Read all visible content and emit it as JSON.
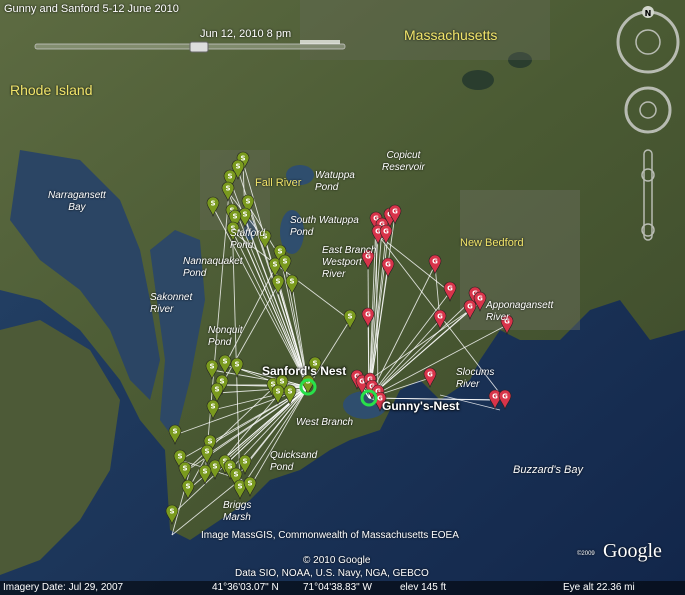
{
  "title": "Gunny and Sanford 5-12 June 2010",
  "timeslider": {
    "label": "Jun 12, 2010   8 pm"
  },
  "regions": {
    "massachusetts": "Massachusetts",
    "rhode_island": "Rhode Island"
  },
  "cities": {
    "fall_river": "Fall River",
    "new_bedford": "New Bedford"
  },
  "water": {
    "narragansett": "Narragansett\nBay",
    "watuppa": "Watuppa\nPond",
    "copicut": "Copicut\nReservoir",
    "south_watuppa": "South Watuppa\nPond",
    "stafford": "Stafford\nPond",
    "nannaquaket": "Nannaquaket\nPond",
    "east_branch": "East Branch\nWestport\nRiver",
    "sakonnet": "Sakonnet\nRiver",
    "nonquit": "Nonquit\nPond",
    "apponagansett": "Apponagansett\nRiver",
    "slocums": "Slocums\nRiver",
    "west_branch": "West Branch",
    "quicksand": "Quicksand\nPond",
    "briggs": "Briggs\nMarsh",
    "buzzards": "Buzzard's Bay"
  },
  "nests": {
    "sanford": "Sanford's Nest",
    "gunny": "Gunny's-Nest"
  },
  "credits": {
    "image": "Image MassGIS, Commonwealth of Massachusetts EOEA",
    "copyright": "© 2010 Google",
    "data": "Data SIO, NOAA, U.S. Navy, NGA, GEBCO",
    "logo_small": "©2009",
    "logo": "Google"
  },
  "compass": {
    "north": "N"
  },
  "status": {
    "imagery_date": "Imagery Date: Jul 29, 2007",
    "lat": "41°36'03.07\" N",
    "lon": "71°04'38.83\" W",
    "elev": "elev   145 ft",
    "eye_alt": "Eye alt    22.36 mi"
  },
  "colors": {
    "sanford": "#7a9a1e",
    "gunny": "#d8344a",
    "track": "#ffffff",
    "label": "#f2e56b"
  },
  "markers": {
    "sanford_letter": "S",
    "gunny_letter": "G"
  }
}
